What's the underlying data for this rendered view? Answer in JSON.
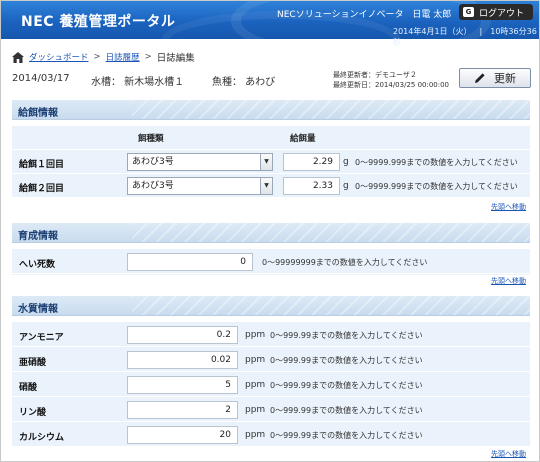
{
  "header": {
    "app_title": "NEC 養殖管理ポータル",
    "org": "NECソリューションイノベータ",
    "user": "日電 太郎",
    "logout_label": "ログアウト",
    "logout_icon_text": "G",
    "date": "2014年4月1日（火）",
    "sep": "|",
    "time": "10時36分36秒"
  },
  "breadcrumb": {
    "home": "ダッシュボード",
    "sep1": ">",
    "list": "日誌履歴",
    "sep2": ">",
    "current": "日誌編集"
  },
  "summary": {
    "date": "2014/03/17",
    "tank": "水槽： 新木場水槽１",
    "species": "魚種： あわび",
    "updated_by": "最終更新者：デモユーザ２",
    "updated_at": "最終更新日：2014/03/25 00:00:00",
    "update_button": "更新"
  },
  "feeding": {
    "title": "給餌情報",
    "col_type": "餌種類",
    "col_amount": "給餌量",
    "rows": [
      {
        "label": "給餌１回目",
        "feed": "あわび3号",
        "amount": "2.29",
        "unit": "g",
        "hint": "0～9999.999までの数値を入力してください"
      },
      {
        "label": "給餌２回目",
        "feed": "あわび3号",
        "amount": "2.33",
        "unit": "g",
        "hint": "0～9999.999までの数値を入力してください"
      }
    ],
    "top_link": "先頭へ移動"
  },
  "growth": {
    "title": "育成情報",
    "rows": [
      {
        "label": "へい死数",
        "value": "0",
        "hint": "0～99999999までの数値を入力してください"
      }
    ],
    "top_link": "先頭へ移動"
  },
  "water": {
    "title": "水質情報",
    "rows": [
      {
        "label": "アンモニア",
        "value": "0.2",
        "unit": "ppm",
        "hint": "0～999.99までの数値を入力してください"
      },
      {
        "label": "亜硝酸",
        "value": "0.02",
        "unit": "ppm",
        "hint": "0～999.99までの数値を入力してください"
      },
      {
        "label": "硝酸",
        "value": "5",
        "unit": "ppm",
        "hint": "0～999.99までの数値を入力してください"
      },
      {
        "label": "リン酸",
        "value": "2",
        "unit": "ppm",
        "hint": "0～999.99までの数値を入力してください"
      },
      {
        "label": "カルシウム",
        "value": "20",
        "unit": "ppm",
        "hint": "0～999.99までの数値を入力してください"
      }
    ],
    "top_link": "先頭へ移動"
  }
}
